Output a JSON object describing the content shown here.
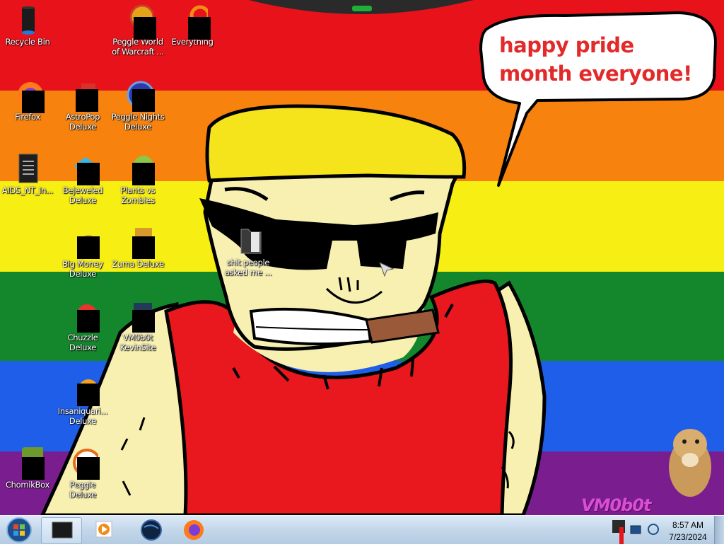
{
  "desktop": {
    "speech_bubble": "happy pride month everyone!",
    "signature": "VM0b0t",
    "icons": [
      {
        "label": "Recycle Bin"
      },
      {
        "label": "Peggle World of Warcraft ..."
      },
      {
        "label": "Everything"
      },
      {
        "label": "Firefox"
      },
      {
        "label": "AstroPop Deluxe"
      },
      {
        "label": "Peggle Nights Deluxe"
      },
      {
        "label": "AIDS_NT_In..."
      },
      {
        "label": "Bejeweled Deluxe"
      },
      {
        "label": "Plants vs Zombies"
      },
      {
        "label": "Big Money Deluxe"
      },
      {
        "label": "Zuma Deluxe"
      },
      {
        "label": "Chuzzle Deluxe"
      },
      {
        "label": "VM0b0t KevinSite"
      },
      {
        "label": "Insaniquari... Deluxe"
      },
      {
        "label": "ChomikBox"
      },
      {
        "label": "Peggle Deluxe"
      },
      {
        "label": "shit people asked me ..."
      }
    ]
  },
  "taskbar": {
    "pinned": [
      "terminal-icon",
      "media-player-icon",
      "globe-icon",
      "firefox-icon"
    ],
    "clock_time": "8:57 AM",
    "clock_date": "7/23/2024"
  },
  "colors": {
    "pride_red": "#e8121a",
    "pride_orange": "#f7820e",
    "pride_yellow": "#f7ee14",
    "pride_green": "#14872d",
    "pride_blue": "#1f5ee8",
    "pride_purple": "#7a1d8f",
    "bubble_text": "#e22a2a"
  }
}
